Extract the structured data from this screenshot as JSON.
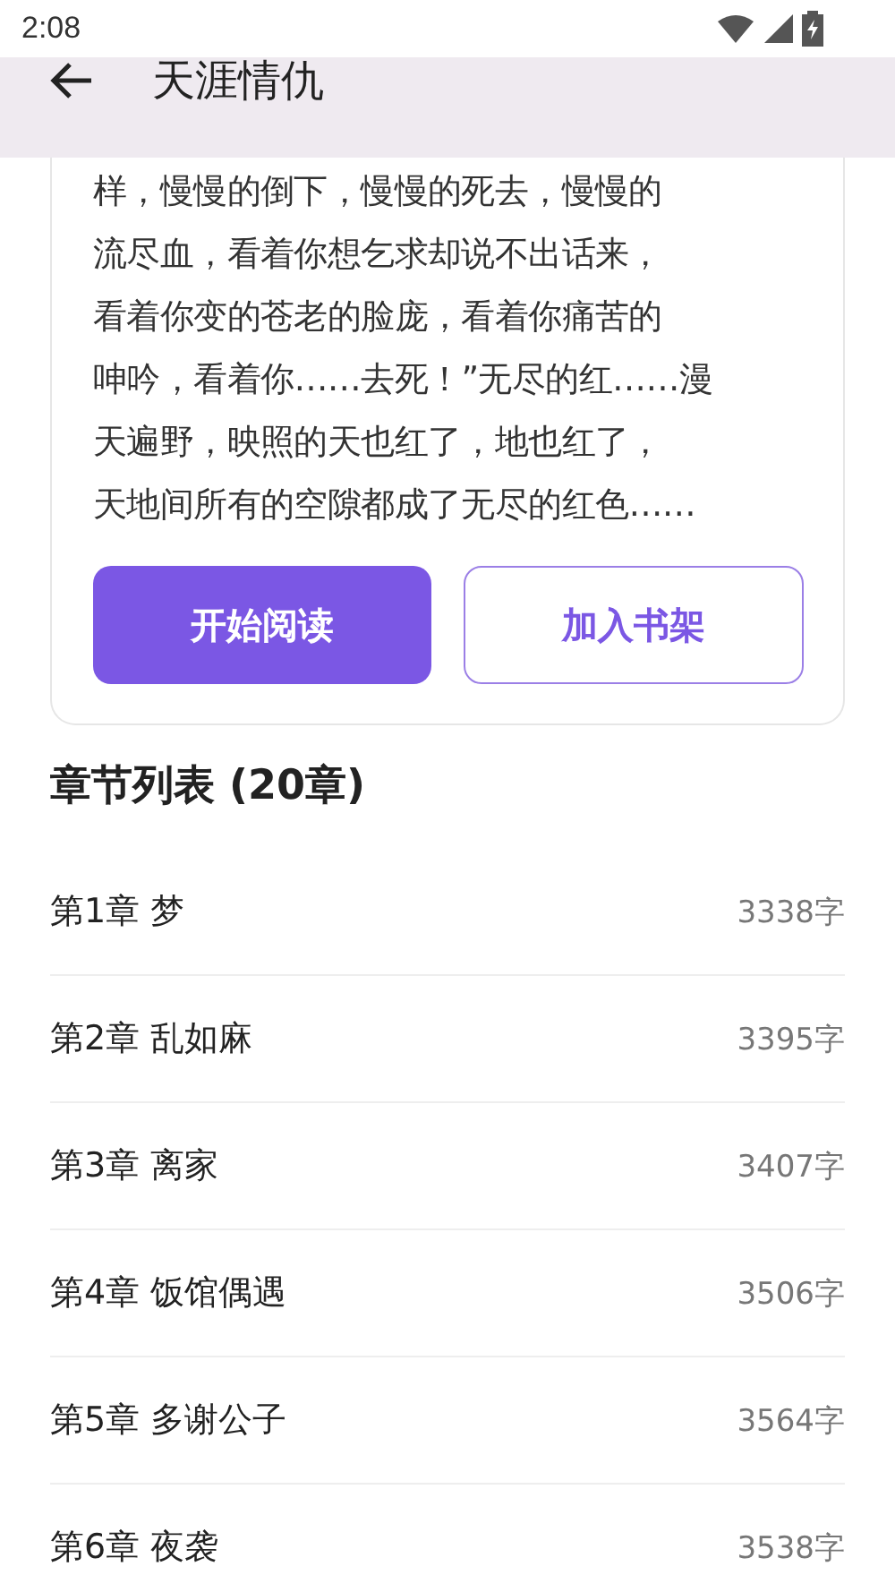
{
  "status_bar": {
    "time": "2:08"
  },
  "app_bar": {
    "title": "天涯情仇"
  },
  "intro": {
    "lines": [
      "样，慢慢的倒下，慢慢的死去，慢慢的",
      "流尽血，看着你想乞求却说不出话来，",
      "看着你变的苍老的脸庞，看着你痛苦的",
      "呻吟，看着你……去死！”无尽的红……漫",
      "天遍野，映照的天也红了，地也红了，",
      "天地间所有的空隙都成了无尽的红色……"
    ],
    "buttons": [
      {
        "label": "开始阅读",
        "kind": "filled"
      },
      {
        "label": "加入书架",
        "kind": "outlined"
      }
    ]
  },
  "chapters": {
    "heading": "章节列表 (20章)",
    "items": [
      {
        "title": "第1章  梦",
        "words": "3338字"
      },
      {
        "title": "第2章  乱如麻",
        "words": "3395字"
      },
      {
        "title": "第3章  离家",
        "words": "3407字"
      },
      {
        "title": "第4章  饭馆偶遇",
        "words": "3506字"
      },
      {
        "title": "第5章  多谢公子",
        "words": "3564字"
      },
      {
        "title": "第6章  夜袭",
        "words": "3538字"
      }
    ]
  }
}
